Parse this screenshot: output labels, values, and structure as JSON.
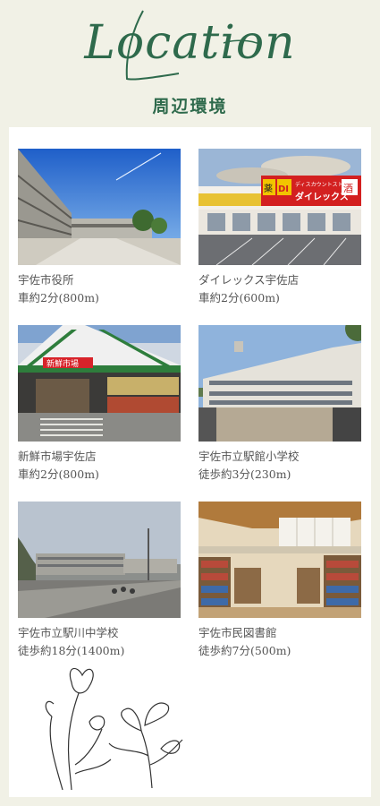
{
  "header": {
    "title_script": "Location",
    "title_jp": "周辺環境"
  },
  "places": [
    {
      "name": "宇佐市役所",
      "distance": "車約2分(800m)"
    },
    {
      "name": "ダイレックス宇佐店",
      "distance": "車約2分(600m)",
      "sign_text": "ダイレックス",
      "sign_small": "ディスカウントストア",
      "logo_text": "DI",
      "sub_logo": "薬",
      "sub_logo2": "酒"
    },
    {
      "name": "新鮮市場宇佐店",
      "distance": "車約2分(800m)",
      "sign_text": "新鮮市場"
    },
    {
      "name": "宇佐市立駅館小学校",
      "distance": "徒歩約3分(230m)"
    },
    {
      "name": "宇佐市立駅川中学校",
      "distance": "徒歩約18分(1400m)"
    },
    {
      "name": "宇佐市民図書館",
      "distance": "徒歩約7分(500m)"
    }
  ],
  "colors": {
    "background": "#f1f1e6",
    "accent": "#2e6a4c",
    "card": "#ffffff"
  },
  "decoration": "line-art-flowers"
}
